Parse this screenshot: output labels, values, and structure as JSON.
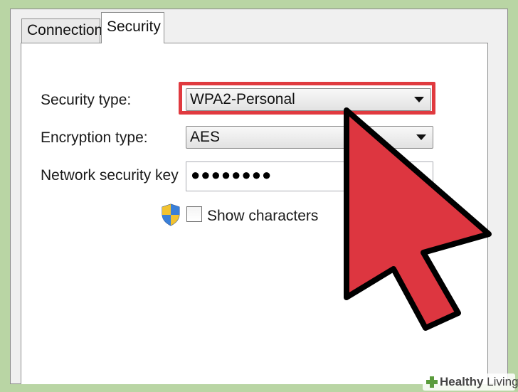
{
  "tabs": {
    "connection": "Connection",
    "security": "Security"
  },
  "fields": {
    "security_type_label": "Security type:",
    "security_type_value": "WPA2-Personal",
    "encryption_type_label": "Encryption type:",
    "encryption_type_value": "AES",
    "network_key_label": "Network security key",
    "network_key_value": "●●●●●●●●"
  },
  "show_characters": {
    "label": "Show characters",
    "checked": false
  },
  "watermark": {
    "bold": "Healthy",
    "rest": " Living"
  },
  "colors": {
    "highlight": "#e03a3f",
    "cursor": "#dd3640",
    "background": "#b9d5a4"
  },
  "icons": {
    "shield": "uac-shield-icon",
    "cursor": "arrow-cursor-icon",
    "dropdown": "chevron-down-icon"
  }
}
